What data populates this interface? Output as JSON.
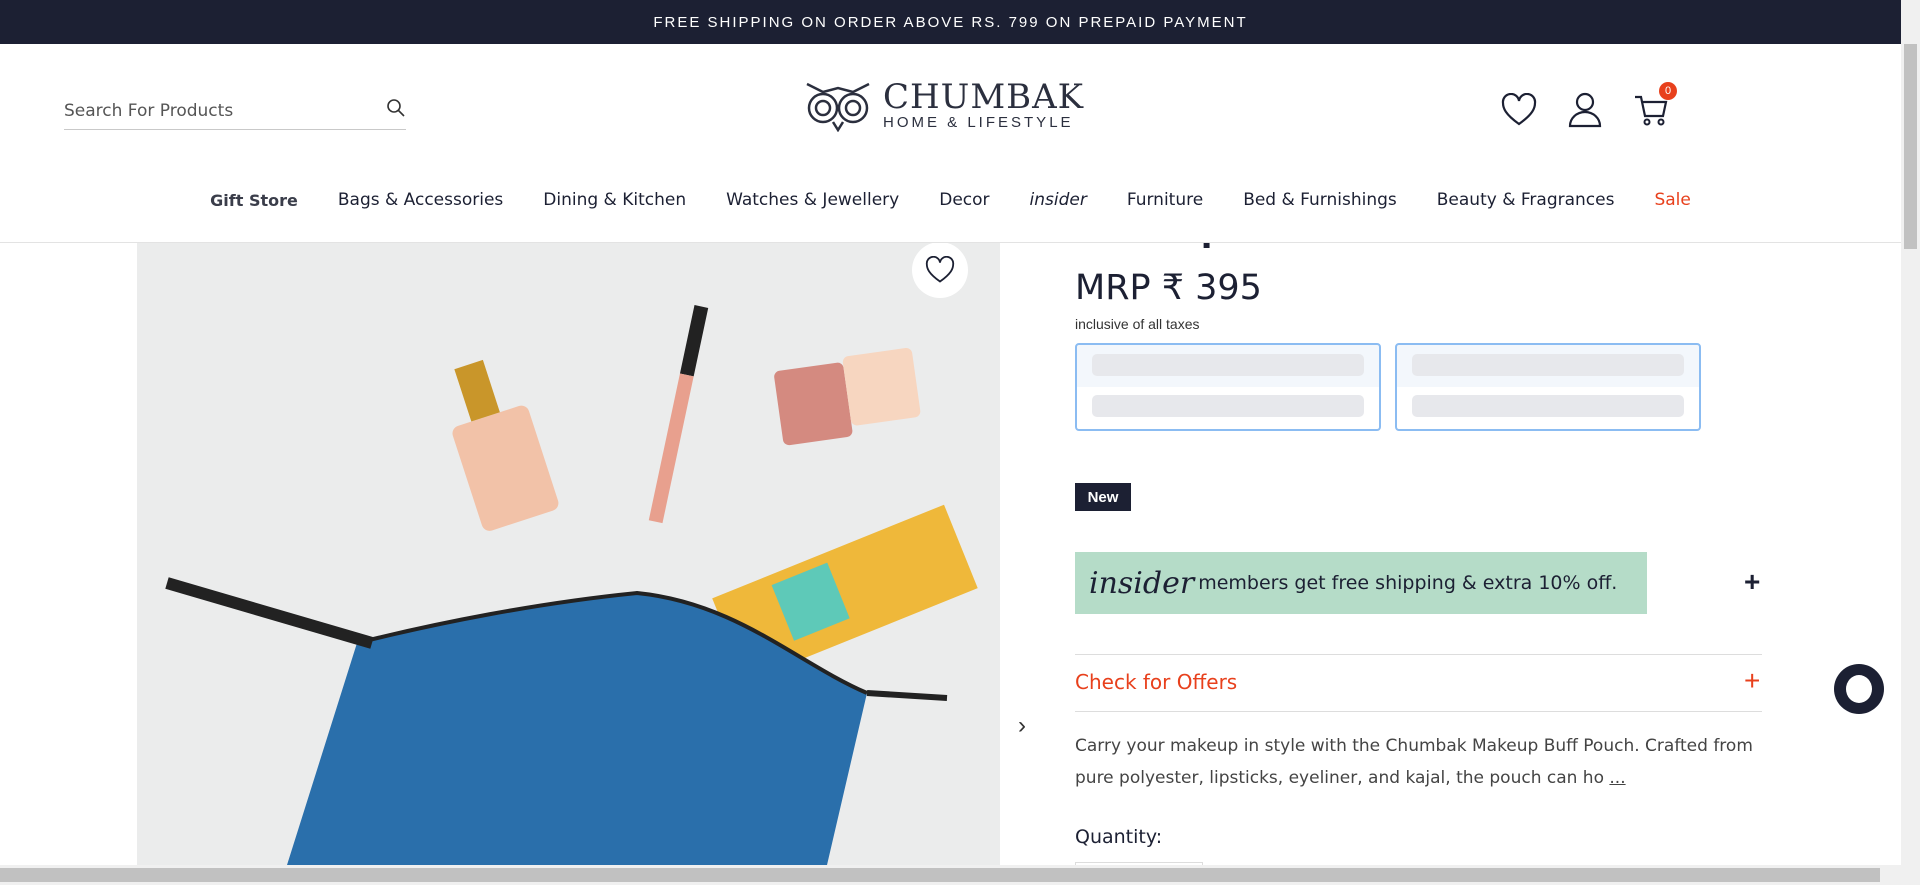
{
  "banner": {
    "text": "FREE SHIPPING ON ORDER ABOVE RS. 799 ON PREPAID PAYMENT"
  },
  "header": {
    "search_placeholder": "Search For Products",
    "logo": {
      "name": "CHUMBAK",
      "tagline": "HOME & LIFESTYLE"
    },
    "cart_count": "0"
  },
  "nav": {
    "items": [
      "Gift Store",
      "Bags & Accessories",
      "Dining & Kitchen",
      "Watches & Jewellery",
      "Decor",
      "insider",
      "Furniture",
      "Bed & Furnishings",
      "Beauty & Fragrances",
      "Sale"
    ]
  },
  "product": {
    "title": "Makeup Buff Pouch Blue & Green",
    "price": "MRP ₹ 395",
    "tax_note": "inclusive of all taxes",
    "badge": "New",
    "insider_logo": "insider",
    "insider_text": "members get free shipping & extra 10% off.",
    "offers_label": "Check for Offers",
    "description": "Carry your makeup in style with the Chumbak Makeup Buff Pouch. Crafted from pure polyester, lipsticks, eyeliner, and kajal, the pouch can ho",
    "more": "...",
    "quantity_label": "Quantity:"
  },
  "colors": {
    "navy": "#1c2033",
    "accent": "#e8401c",
    "insider_bg": "#b5dcc8"
  }
}
